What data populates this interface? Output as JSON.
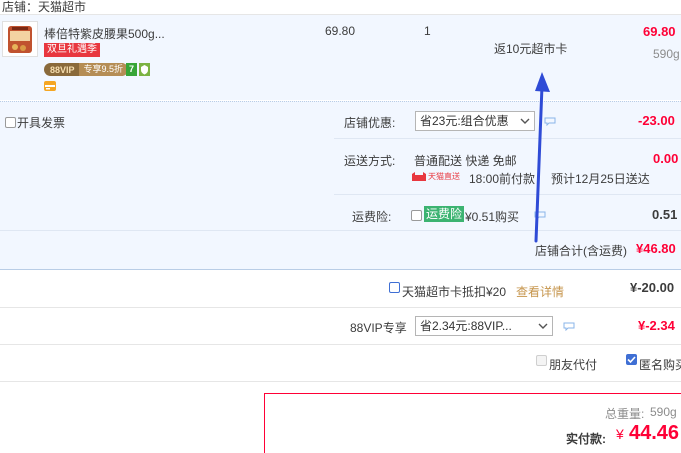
{
  "store": {
    "label": "店铺：天猫超市"
  },
  "item": {
    "name": "棒倍特紫皮腰果500g...",
    "promo_badge": "双旦礼遇季",
    "vip_badge": "88VIP",
    "vip_discount": "专享9.5折",
    "seven_day_badge": "7",
    "price": "69.80",
    "quantity": "1",
    "rebate": "返10元超市卡",
    "subtotal": "69.80",
    "weight": "590g"
  },
  "invoice": {
    "label": "开具发票",
    "checked": false
  },
  "shop_discount": {
    "label": "店铺优惠:",
    "selected": "省23元:组合优惠",
    "amount": "-23.00"
  },
  "shipping": {
    "label": "运送方式:",
    "method": "普通配送 快递 免邮",
    "carrier_logo_text": "天猫直送",
    "cutoff": "18:00前付款",
    "eta": "预计12月25日送达",
    "amount": "0.00"
  },
  "insurance": {
    "label": "运费险:",
    "badge": "运费险",
    "text": "¥0.51购买",
    "amount": "0.51",
    "checked": false
  },
  "shop_total": {
    "label": "店铺合计(含运费)",
    "amount": "¥46.80"
  },
  "supermarket_card": {
    "label": "天猫超市卡抵扣¥20",
    "link": "查看详情",
    "amount": "¥-20.00",
    "checked": false
  },
  "vip88": {
    "label": "88VIP专享",
    "selected": "省2.34元:88VIP...",
    "amount": "¥-2.34"
  },
  "options": {
    "friend_pay": "朋友代付",
    "anonymous": "匿名购买",
    "anonymous_checked": true
  },
  "summary": {
    "weight_label": "总重量:",
    "weight_value": "590g",
    "pay_label": "实付款:",
    "currency": "¥",
    "pay_amount": "44.46"
  },
  "colors": {
    "accent_red": "#ff0036",
    "band_blue": "#f2f7ff",
    "annotation_arrow": "#2f4bd6",
    "insurance_green": "#3cb371"
  }
}
